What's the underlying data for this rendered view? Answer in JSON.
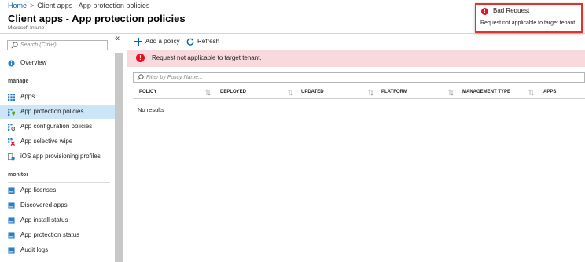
{
  "breadcrumb": {
    "home": "Home",
    "separator": ">",
    "current": "Client apps - App protection policies"
  },
  "header": {
    "title": "Client apps - App protection policies",
    "subtitle": "Microsoft Intune"
  },
  "sidebar": {
    "collapse_glyph": "«",
    "search_placeholder": "Search (Ctrl+/)",
    "overview": {
      "label": "Overview",
      "icon": "info-icon"
    },
    "sections": [
      {
        "label": "manage",
        "items": [
          {
            "label": "Apps",
            "icon": "apps-grid-icon",
            "active": false
          },
          {
            "label": "App protection policies",
            "icon": "app-protection-icon",
            "active": true
          },
          {
            "label": "App configuration policies",
            "icon": "app-config-icon",
            "active": false
          },
          {
            "label": "App selective wipe",
            "icon": "wipe-icon",
            "active": false
          },
          {
            "label": "iOS app provisioning profiles",
            "icon": "provisioning-icon",
            "active": false
          }
        ]
      },
      {
        "label": "monitor",
        "items": [
          {
            "label": "App licenses",
            "icon": "report-icon",
            "active": false
          },
          {
            "label": "Discovered apps",
            "icon": "report-icon",
            "active": false
          },
          {
            "label": "App install status",
            "icon": "report-icon",
            "active": false
          },
          {
            "label": "App protection status",
            "icon": "report-icon",
            "active": false
          },
          {
            "label": "Audit logs",
            "icon": "report-icon",
            "active": false
          }
        ]
      }
    ]
  },
  "toolbar": {
    "add_label": "Add a policy",
    "refresh_label": "Refresh"
  },
  "banner": {
    "message": "Request not applicable to target tenant."
  },
  "filter": {
    "placeholder": "Filter by Policy Name..."
  },
  "table": {
    "columns": [
      "POLICY",
      "DEPLOYED",
      "UPDATED",
      "PLATFORM",
      "MANAGEMENT TYPE",
      "APPS"
    ],
    "empty_text": "No results"
  },
  "toast": {
    "title": "Bad Request",
    "message": "Request not applicable to target tenant."
  },
  "colors": {
    "accent": "#0063b1",
    "error": "#e81123",
    "banner_bg": "#f7d9de",
    "active_item_bg": "#cde6f7"
  }
}
